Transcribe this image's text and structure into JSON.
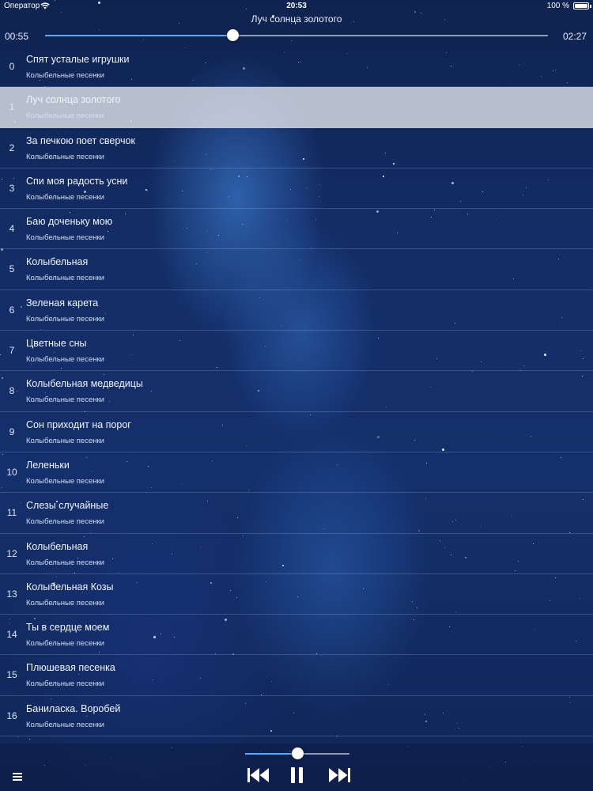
{
  "status_bar": {
    "carrier": "Оператор",
    "time": "20:53",
    "battery": "100 %"
  },
  "player": {
    "now_playing": "Луч солнца золотого",
    "elapsed": "00:55",
    "total": "02:27",
    "progress": 0.374,
    "volume": 0.5
  },
  "tracks": [
    {
      "index": "0",
      "title": "Спят усталые игрушки",
      "subtitle": "Колыбельные песенки"
    },
    {
      "index": "1",
      "title": "Луч солнца золотого",
      "subtitle": "Колыбельные песенки",
      "active": true
    },
    {
      "index": "2",
      "title": "За печкою поет сверчок",
      "subtitle": "Колыбельные песенки"
    },
    {
      "index": "3",
      "title": "Спи моя радость усни",
      "subtitle": "Колыбельные песенки"
    },
    {
      "index": "4",
      "title": "Баю доченьку мою",
      "subtitle": "Колыбельные песенки"
    },
    {
      "index": "5",
      "title": "Колыбельная",
      "subtitle": "Колыбельные песенки"
    },
    {
      "index": "6",
      "title": "Зеленая карета",
      "subtitle": "Колыбельные песенки"
    },
    {
      "index": "7",
      "title": "Цветные сны",
      "subtitle": "Колыбельные песенки"
    },
    {
      "index": "8",
      "title": "Колыбельная медведицы",
      "subtitle": "Колыбельные песенки"
    },
    {
      "index": "9",
      "title": "Сон приходит на порог",
      "subtitle": "Колыбельные песенки"
    },
    {
      "index": "10",
      "title": "Леленьки",
      "subtitle": "Колыбельные песенки"
    },
    {
      "index": "11",
      "title": "Слезы случайные",
      "subtitle": "Колыбельные песенки"
    },
    {
      "index": "12",
      "title": "Колыбельная",
      "subtitle": "Колыбельные песенки"
    },
    {
      "index": "13",
      "title": "Колыбельная Козы",
      "subtitle": "Колыбельные песенки"
    },
    {
      "index": "14",
      "title": "Ты в сердце моем",
      "subtitle": "Колыбельные песенки"
    },
    {
      "index": "15",
      "title": "Плюшевая песенка",
      "subtitle": "Колыбельные песенки"
    },
    {
      "index": "16",
      "title": "Баниласка. Воробей",
      "subtitle": "Колыбельные песенки"
    }
  ],
  "colors": {
    "accent": "#5aa8ff",
    "active_row": "#dce0e8"
  },
  "icons": {
    "menu": "hamburger-icon",
    "prev": "skip-previous-icon",
    "pause": "pause-icon",
    "next": "skip-next-icon",
    "wifi": "wifi-icon",
    "battery": "battery-icon"
  }
}
